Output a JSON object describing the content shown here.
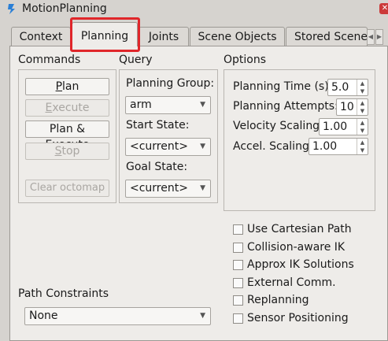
{
  "window": {
    "title": "MotionPlanning",
    "close_symbol": "✕"
  },
  "tabs": [
    {
      "label": "Context",
      "active": false
    },
    {
      "label": "Planning",
      "active": true
    },
    {
      "label": "Joints",
      "active": false
    },
    {
      "label": "Scene Objects",
      "active": false
    },
    {
      "label": "Stored Scene",
      "active": false
    }
  ],
  "tab_scroll": {
    "left": "◀",
    "right": "▶"
  },
  "commands": {
    "heading": "Commands",
    "plan_prefix": "",
    "plan_mnemonic": "P",
    "plan_suffix": "lan",
    "execute_prefix": "",
    "execute_mnemonic": "E",
    "execute_suffix": "xecute",
    "plan_execute_prefix": "Plan & ",
    "plan_execute_mnemonic": "E",
    "plan_execute_suffix": "xecute",
    "stop_prefix": "",
    "stop_mnemonic": "S",
    "stop_suffix": "top",
    "clear_octomap": "Clear octomap"
  },
  "query": {
    "heading": "Query",
    "planning_group_label": "Planning Group:",
    "planning_group_value": "arm",
    "start_state_label": "Start State:",
    "start_state_value": "<current>",
    "goal_state_label": "Goal State:",
    "goal_state_value": "<current>"
  },
  "options": {
    "heading": "Options",
    "planning_time_label": "Planning Time (s):",
    "planning_time_value": "5.0",
    "planning_attempts_label": "Planning Attempts:",
    "planning_attempts_value": "10",
    "velocity_scaling_label": "Velocity Scaling:",
    "velocity_scaling_value": "1.00",
    "accel_scaling_label": "Accel. Scaling:",
    "accel_scaling_value": "1.00",
    "checkboxes": [
      {
        "label": "Use Cartesian Path",
        "checked": false
      },
      {
        "label": "Collision-aware IK",
        "checked": false
      },
      {
        "label": "Approx IK Solutions",
        "checked": false
      },
      {
        "label": "External Comm.",
        "checked": false
      },
      {
        "label": "Replanning",
        "checked": false
      },
      {
        "label": "Sensor Positioning",
        "checked": false
      }
    ]
  },
  "path_constraints": {
    "heading": "Path Constraints",
    "value": "None"
  },
  "icons": {
    "combo_arrow": "▼",
    "spin_up": "▲",
    "spin_down": "▼"
  },
  "colors": {
    "highlight_box": "#e0262a",
    "app_icon": "#2a7fd6"
  }
}
